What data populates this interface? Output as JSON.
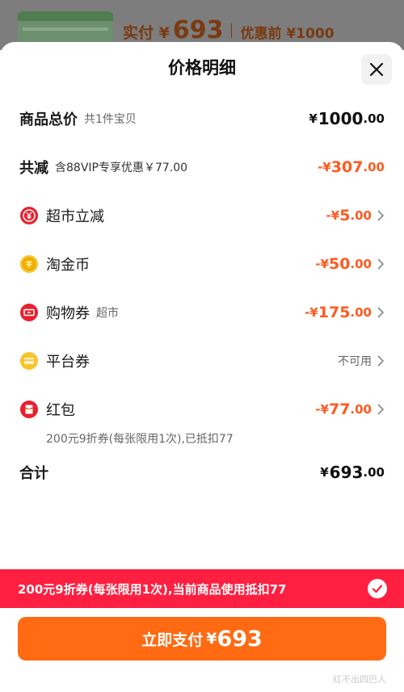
{
  "background": {
    "paid_label": "实付 ¥",
    "paid_amount": "693",
    "before_label": "优惠前 ¥1000"
  },
  "sheet": {
    "title": "价格明细"
  },
  "rows": {
    "total": {
      "label": "商品总价",
      "note": "共1件宝贝",
      "currency": "¥",
      "integer": "1000",
      "decimal": ".00"
    },
    "reduction": {
      "label": "共减",
      "note": "含88VIP专享优惠￥77.00",
      "prefix": "-¥",
      "integer": "307",
      "decimal": ".00"
    },
    "supermarket": {
      "label": "超市立减",
      "prefix": "-¥",
      "integer": "5",
      "decimal": ".00"
    },
    "coins": {
      "label": "淘金币",
      "prefix": "-¥",
      "integer": "50",
      "decimal": ".00"
    },
    "shopping_coupon": {
      "label": "购物券",
      "note": "超市",
      "prefix": "-¥",
      "integer": "175",
      "decimal": ".00"
    },
    "platform_coupon": {
      "label": "平台券",
      "value": "不可用"
    },
    "red_packet": {
      "label": "红包",
      "prefix": "-¥",
      "integer": "77",
      "decimal": ".00",
      "detail": "200元9折券(每张限用1次),已抵扣77"
    },
    "sum": {
      "label": "合计",
      "currency": "¥",
      "integer": "693",
      "decimal": ".00"
    }
  },
  "banner": {
    "text": "200元9折券(每张限用1次),当前商品使用抵扣77"
  },
  "pay_button": {
    "label": "立即支付",
    "currency": "¥",
    "amount": "693"
  },
  "watermark": "红不出四巴人",
  "colors": {
    "accent_orange": "#ff6a13",
    "discount_orange": "#ff5a1f",
    "banner_red": "#ff1f40"
  },
  "icons": {
    "supermarket": "red-coin-icon",
    "coins": "gold-coin-icon",
    "shopping_coupon": "red-ticket-icon",
    "platform_coupon": "yellow-ticket-icon",
    "red_packet": "red-packet-icon"
  }
}
